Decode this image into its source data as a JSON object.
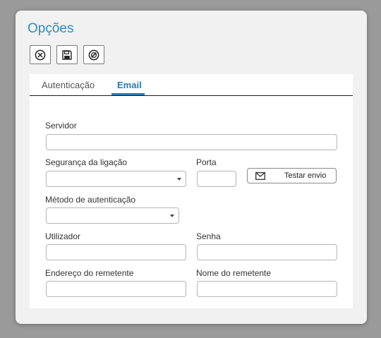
{
  "dialog": {
    "title": "Opções"
  },
  "toolbar": {
    "close": {
      "icon": "close-circle-icon"
    },
    "save": {
      "icon": "floppy-disk-icon"
    },
    "cancel": {
      "icon": "block-circle-icon"
    }
  },
  "tabs": [
    {
      "label": "Autenticação",
      "active": false
    },
    {
      "label": "Email",
      "active": true
    }
  ],
  "form": {
    "server": {
      "label": "Servidor",
      "value": ""
    },
    "security": {
      "label": "Segurança da ligação",
      "value": ""
    },
    "port": {
      "label": "Porta",
      "value": ""
    },
    "test_button": {
      "label": "Testar envio",
      "icon": "envelope-icon"
    },
    "auth_method": {
      "label": "Método de autenticação",
      "value": ""
    },
    "user": {
      "label": "Utilizador",
      "value": ""
    },
    "password": {
      "label": "Senha",
      "value": ""
    },
    "sender_address": {
      "label": "Endereço do remetente",
      "value": ""
    },
    "sender_name": {
      "label": "Nome do remetente",
      "value": ""
    }
  },
  "colors": {
    "accent": "#2a8cc3",
    "tab_active": "#2a7ab0",
    "backdrop": "#9a9a9a"
  }
}
